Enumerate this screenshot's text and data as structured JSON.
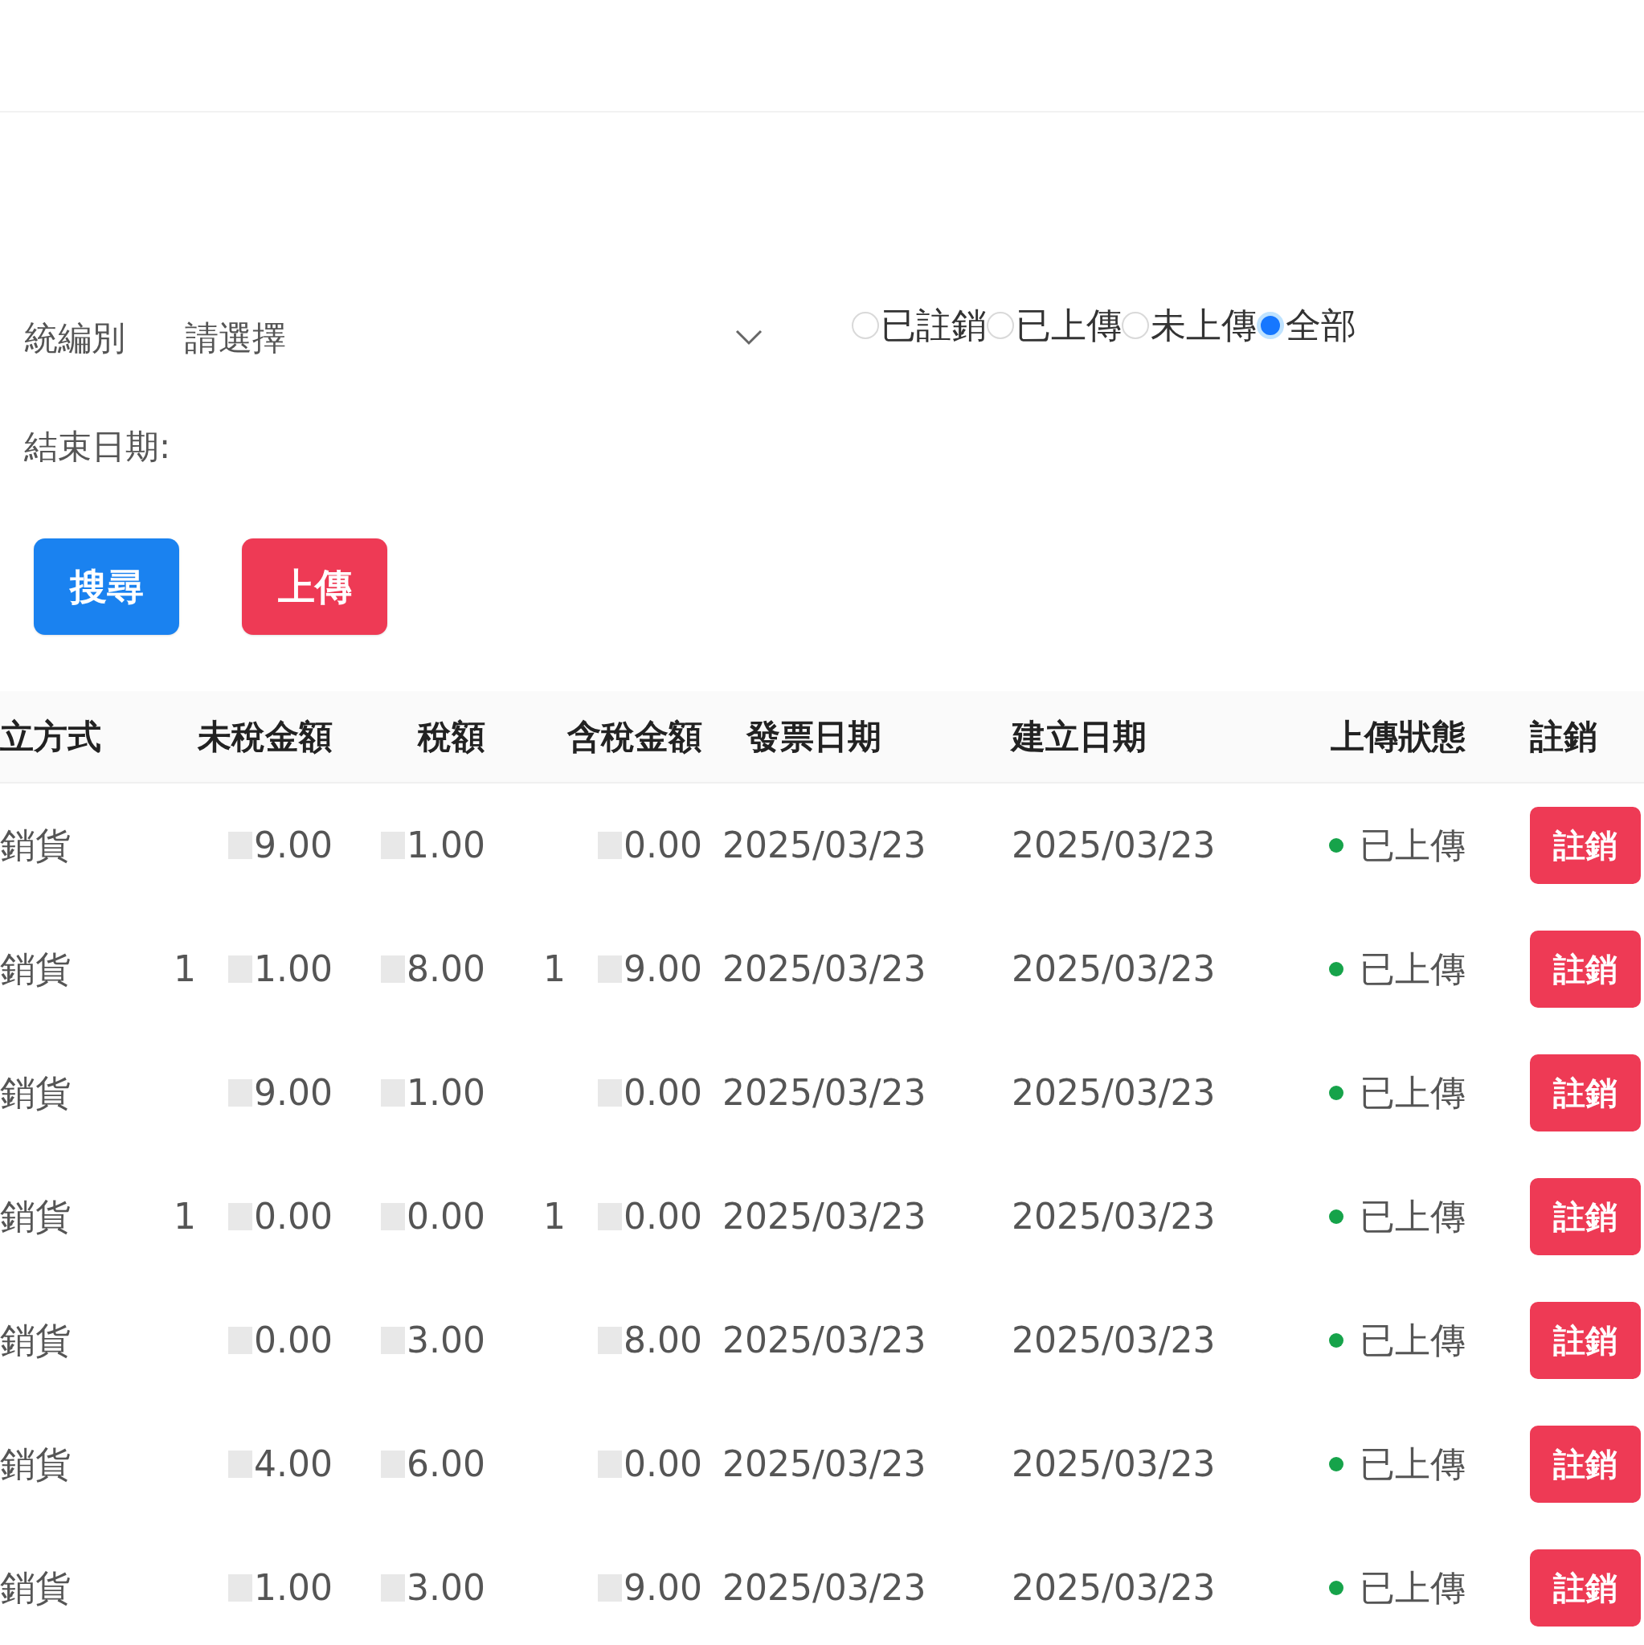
{
  "filters": {
    "company_label": "統編別",
    "company_select": {
      "placeholder": "請選擇"
    },
    "status_options": [
      {
        "label": "已註銷",
        "selected": false
      },
      {
        "label": "已上傳",
        "selected": false
      },
      {
        "label": "未上傳",
        "selected": false
      },
      {
        "label": "全部",
        "selected": true
      }
    ],
    "end_date_label": "結束日期:"
  },
  "buttons": [
    {
      "label": "搜尋",
      "kind": "primary"
    },
    {
      "label": "上傳",
      "kind": "danger"
    }
  ],
  "table": {
    "columns": [
      "立方式",
      "未稅金額",
      "稅額",
      "含稅金額",
      "發票日期",
      "建立日期",
      "上傳狀態",
      "註銷"
    ],
    "rows": [
      {
        "method": "銷貨",
        "untaxed": {
          "value": "9.00"
        },
        "tax": {
          "value": "1.00"
        },
        "total": {
          "value": "0.00"
        },
        "invoice_date": "2025/03/23",
        "created_date": "2025/03/23",
        "status": {
          "label": "已上傳",
          "color": "#16a34a"
        },
        "action": "註銷"
      },
      {
        "method": "銷貨",
        "untaxed": {
          "prefix": "1",
          "value": "1.00"
        },
        "tax": {
          "value": "8.00"
        },
        "total": {
          "prefix": "1",
          "value": "9.00"
        },
        "invoice_date": "2025/03/23",
        "created_date": "2025/03/23",
        "status": {
          "label": "已上傳",
          "color": "#16a34a"
        },
        "action": "註銷"
      },
      {
        "method": "銷貨",
        "untaxed": {
          "value": "9.00"
        },
        "tax": {
          "value": "1.00"
        },
        "total": {
          "value": "0.00"
        },
        "invoice_date": "2025/03/23",
        "created_date": "2025/03/23",
        "status": {
          "label": "已上傳",
          "color": "#16a34a"
        },
        "action": "註銷"
      },
      {
        "method": "銷貨",
        "untaxed": {
          "prefix": "1",
          "value": "0.00"
        },
        "tax": {
          "value": "0.00"
        },
        "total": {
          "prefix": "1",
          "value": "0.00"
        },
        "invoice_date": "2025/03/23",
        "created_date": "2025/03/23",
        "status": {
          "label": "已上傳",
          "color": "#16a34a"
        },
        "action": "註銷"
      },
      {
        "method": "銷貨",
        "untaxed": {
          "value": "0.00"
        },
        "tax": {
          "value": "3.00"
        },
        "total": {
          "value": "8.00"
        },
        "invoice_date": "2025/03/23",
        "created_date": "2025/03/23",
        "status": {
          "label": "已上傳",
          "color": "#16a34a"
        },
        "action": "註銷"
      },
      {
        "method": "銷貨",
        "untaxed": {
          "value": "4.00"
        },
        "tax": {
          "value": "6.00"
        },
        "total": {
          "value": "0.00"
        },
        "invoice_date": "2025/03/23",
        "created_date": "2025/03/23",
        "status": {
          "label": "已上傳",
          "color": "#16a34a"
        },
        "action": "註銷"
      },
      {
        "method": "銷貨",
        "untaxed": {
          "value": "1.00"
        },
        "tax": {
          "value": "3.00"
        },
        "total": {
          "value": "9.00"
        },
        "invoice_date": "2025/03/23",
        "created_date": "2025/03/23",
        "status": {
          "label": "已上傳",
          "color": "#16a34a"
        },
        "action": "註銷"
      }
    ]
  }
}
